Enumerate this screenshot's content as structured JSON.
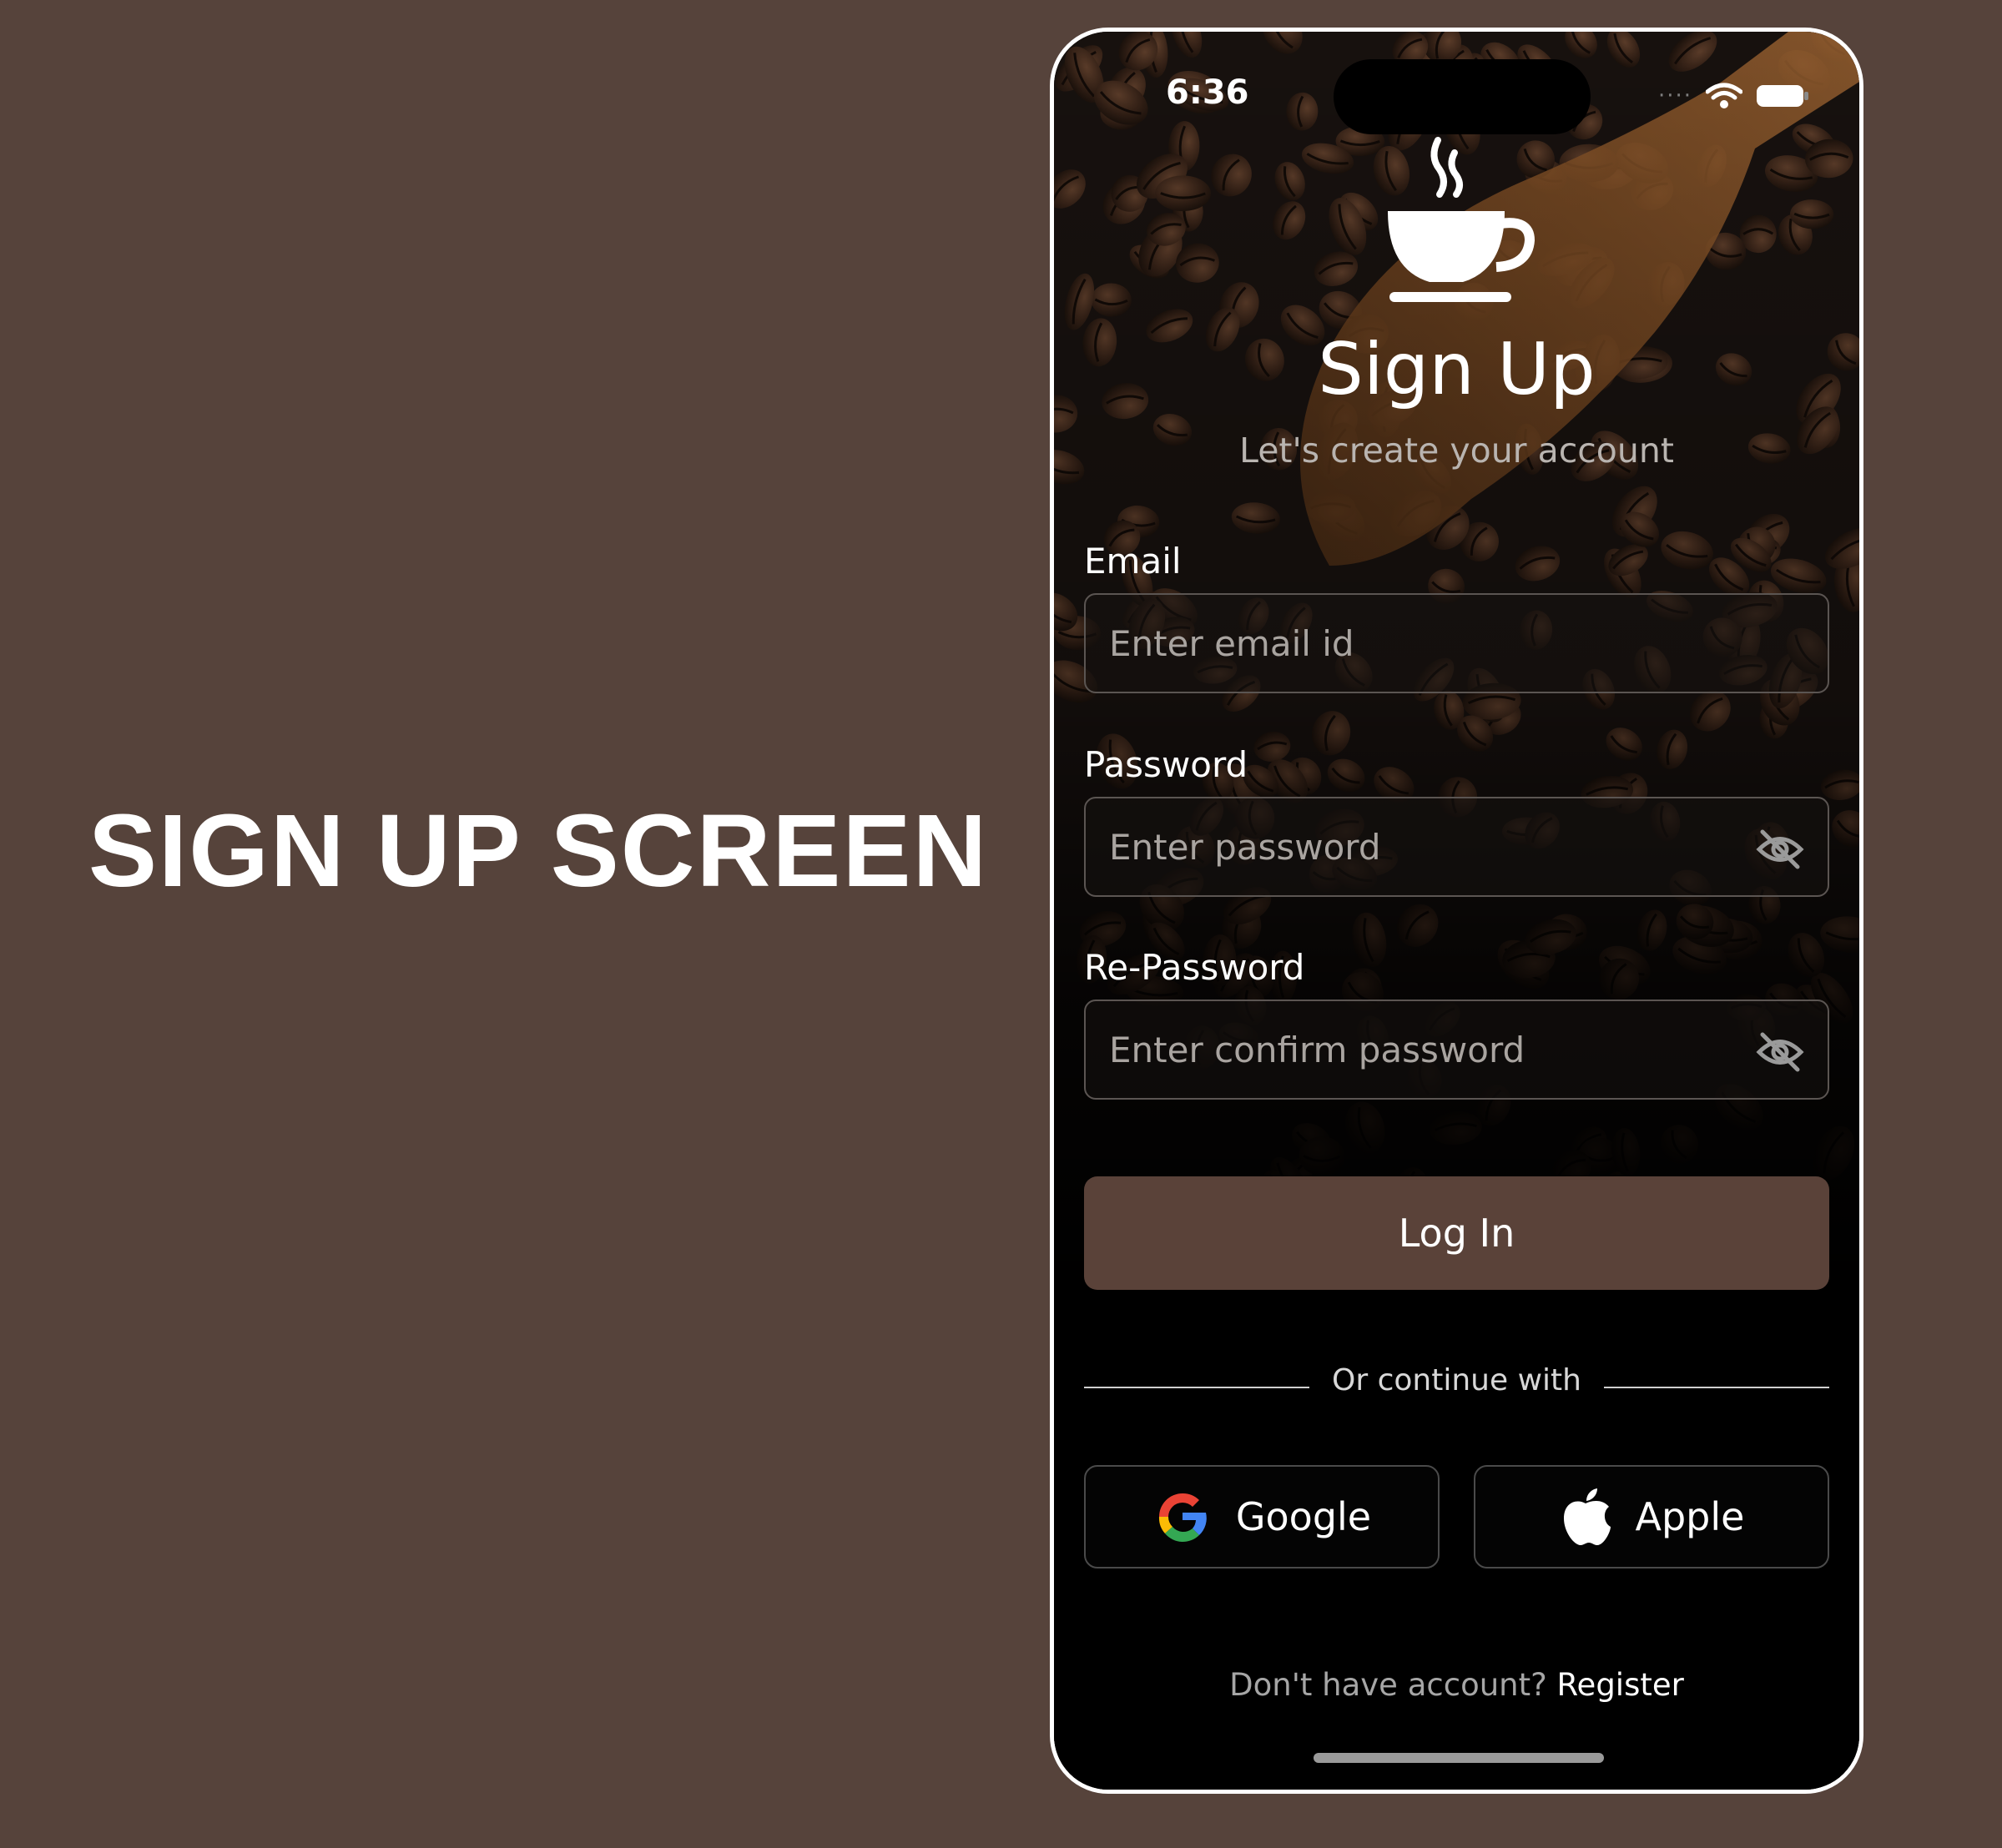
{
  "headline": "SIGN UP SCREEN",
  "status_bar": {
    "time": "6:36",
    "signal_dots": "····"
  },
  "screen": {
    "title": "Sign Up",
    "subtitle": "Let's create your account"
  },
  "form": {
    "email": {
      "label": "Email",
      "placeholder": "Enter email id"
    },
    "password": {
      "label": "Password",
      "placeholder": "Enter password"
    },
    "re_password": {
      "label": "Re-Password",
      "placeholder": "Enter confirm password"
    }
  },
  "login_button": {
    "label": "Log In"
  },
  "divider_text": "Or continue with",
  "social": {
    "google": {
      "label": "Google"
    },
    "apple": {
      "label": "Apple"
    }
  },
  "footer": {
    "prompt": "Don't have account?",
    "link": "Register"
  },
  "colors": {
    "page_background": "#56433b",
    "primary_button": "#5a4239",
    "phone_frame": "#ffffff"
  }
}
